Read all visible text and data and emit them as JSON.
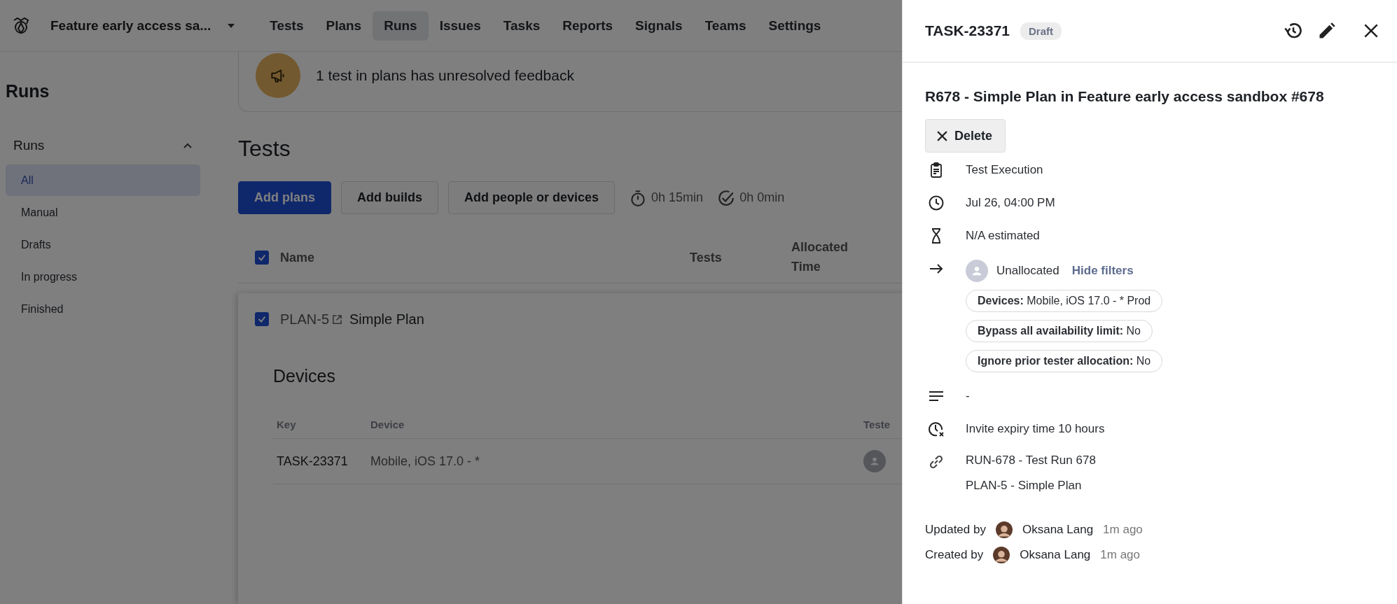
{
  "nav": {
    "project": "Feature early access sa...",
    "tabs": [
      {
        "label": "Tests",
        "selected": false
      },
      {
        "label": "Plans",
        "selected": false
      },
      {
        "label": "Runs",
        "selected": true
      },
      {
        "label": "Issues",
        "selected": false
      },
      {
        "label": "Tasks",
        "selected": false
      },
      {
        "label": "Reports",
        "selected": false
      },
      {
        "label": "Signals",
        "selected": false
      },
      {
        "label": "Teams",
        "selected": false
      },
      {
        "label": "Settings",
        "selected": false
      }
    ]
  },
  "banner": {
    "text": "1 test in plans has unresolved feedback"
  },
  "sidebar": {
    "title": "Runs",
    "section": {
      "label": "Runs",
      "expanded": true
    },
    "items": [
      {
        "label": "All",
        "selected": true
      },
      {
        "label": "Manual",
        "selected": false
      },
      {
        "label": "Drafts",
        "selected": false
      },
      {
        "label": "In progress",
        "selected": false
      },
      {
        "label": "Finished",
        "selected": false
      }
    ]
  },
  "main": {
    "title": "Tests",
    "buttons": [
      {
        "label": "Add plans",
        "kind": "primary"
      },
      {
        "label": "Add builds",
        "kind": "secondary"
      },
      {
        "label": "Add people or devices",
        "kind": "secondary"
      }
    ],
    "stats": [
      {
        "kind": "timer",
        "text": "0h 15min"
      },
      {
        "kind": "done",
        "text": "0h 0min"
      }
    ],
    "table": {
      "all_checked": true,
      "columns": [
        "Name",
        "Tests",
        "Allocated Time"
      ]
    },
    "plan": {
      "checked": true,
      "key": "PLAN-5",
      "name": "Simple Plan",
      "devices": {
        "title": "Devices",
        "columns": [
          "Key",
          "Device",
          "Teste"
        ],
        "rows": [
          {
            "key": "TASK-23371",
            "device": "Mobile, iOS 17.0 - *"
          }
        ]
      }
    }
  },
  "panel": {
    "key": "TASK-23371",
    "status": "Draft",
    "title": "R678 - Simple Plan in Feature early access sandbox #678",
    "delete_label": "Delete",
    "details": [
      {
        "kind": "type",
        "text": "Test Execution"
      },
      {
        "kind": "date",
        "text": "Jul 26, 04:00 PM"
      },
      {
        "kind": "estimate",
        "text": "N/A estimated"
      },
      {
        "kind": "assignee",
        "text": "Unallocated",
        "link": "Hide filters",
        "filters": [
          {
            "label": "Devices:",
            "value": "Mobile, iOS 17.0 - * Prod"
          },
          {
            "label": "Bypass all availability limit:",
            "value": "No"
          },
          {
            "label": "Ignore prior tester allocation:",
            "value": "No"
          }
        ]
      },
      {
        "kind": "description",
        "text": "-"
      },
      {
        "kind": "expiry",
        "text": "Invite expiry time 10 hours"
      },
      {
        "kind": "links",
        "lines": [
          "RUN-678 - Test Run 678",
          "PLAN-5 - Simple Plan"
        ]
      }
    ],
    "audit": [
      {
        "label": "Updated by",
        "user": "Oksana Lang",
        "time": "1m ago"
      },
      {
        "label": "Created by",
        "user": "Oksana Lang",
        "time": "1m ago"
      }
    ]
  }
}
